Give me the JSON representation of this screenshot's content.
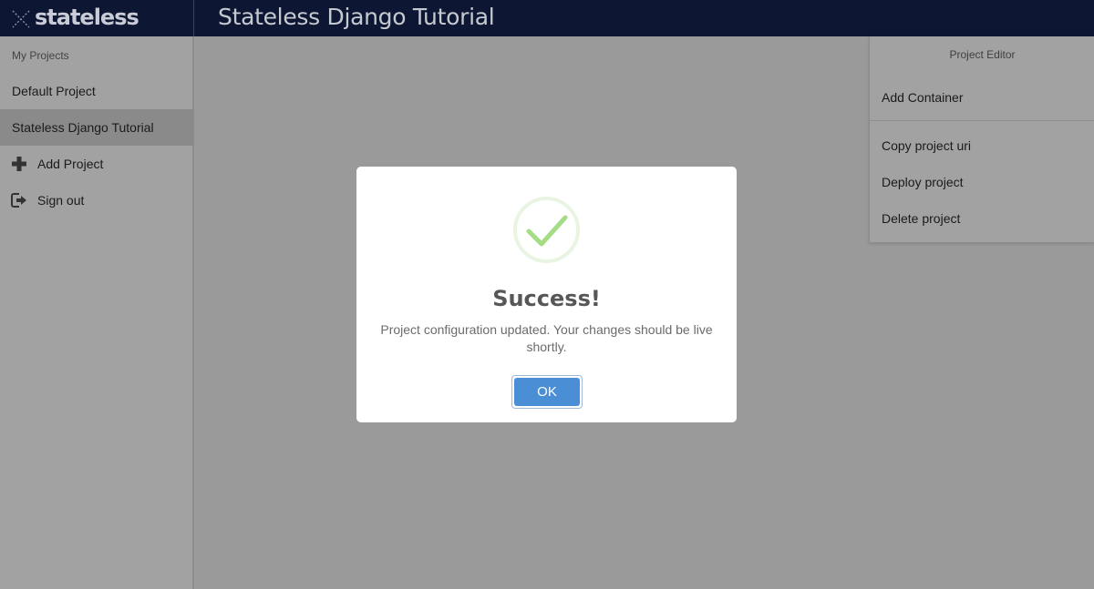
{
  "header": {
    "brand": "stateless",
    "title": "Stateless Django Tutorial"
  },
  "sidebar": {
    "heading": "My Projects",
    "items": [
      {
        "label": "Default Project"
      },
      {
        "label": "Stateless Django Tutorial",
        "active": true
      },
      {
        "label": "Add Project",
        "icon": "plus-icon"
      },
      {
        "label": "Sign out",
        "icon": "sign-out-icon"
      }
    ]
  },
  "editor": {
    "heading": "Project Editor",
    "add_container": "Add Container",
    "copy_uri": "Copy project uri",
    "deploy": "Deploy project",
    "delete": "Delete project"
  },
  "modal": {
    "icon": "success-check-icon",
    "title": "Success!",
    "message": "Project configuration updated. Your changes should be live shortly.",
    "ok_label": "OK"
  },
  "colors": {
    "topbar": "#0d1733",
    "overlay": "#9a9a9a",
    "success": "#a5dc86",
    "button": "#4a8fd6"
  }
}
